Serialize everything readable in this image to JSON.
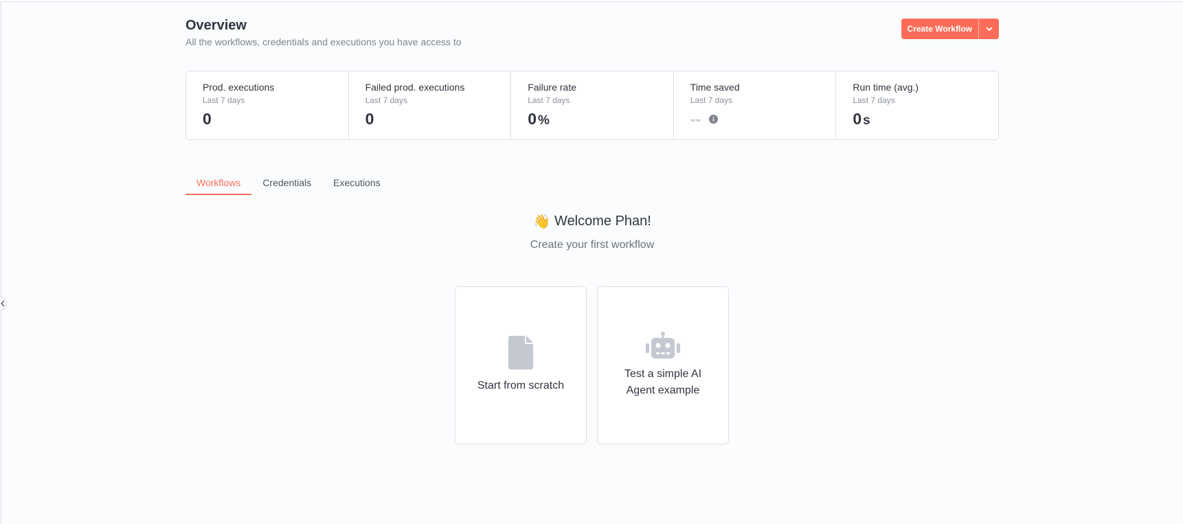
{
  "page": {
    "title": "Overview",
    "subtitle": "All the workflows, credentials and executions you have access to"
  },
  "create_button": {
    "label": "Create Workflow",
    "dropdown_icon": "chevron-down-icon",
    "color": "#ff6d5a"
  },
  "stats": [
    {
      "label": "Prod. executions",
      "period": "Last 7 days",
      "value": "0",
      "unit": ""
    },
    {
      "label": "Failed prod. executions",
      "period": "Last 7 days",
      "value": "0",
      "unit": ""
    },
    {
      "label": "Failure rate",
      "period": "Last 7 days",
      "value": "0",
      "unit": "%"
    },
    {
      "label": "Time saved",
      "period": "Last 7 days",
      "value": "--",
      "unit": "",
      "icon": "info-icon"
    },
    {
      "label": "Run time (avg.)",
      "period": "Last 7 days",
      "value": "0",
      "unit": "s"
    }
  ],
  "tabs": [
    {
      "label": "Workflows",
      "active": true
    },
    {
      "label": "Credentials",
      "active": false
    },
    {
      "label": "Executions",
      "active": false
    }
  ],
  "welcome": {
    "emoji": "👋",
    "title": "Welcome Phan!",
    "subtitle": "Create your first workflow"
  },
  "cards": [
    {
      "label": "Start from scratch",
      "icon": "file-icon"
    },
    {
      "label": "Test a simple AI Agent example",
      "icon": "robot-icon"
    }
  ],
  "colors": {
    "accent": "#ff6d5a",
    "icon_gray": "#c4c8d1"
  }
}
